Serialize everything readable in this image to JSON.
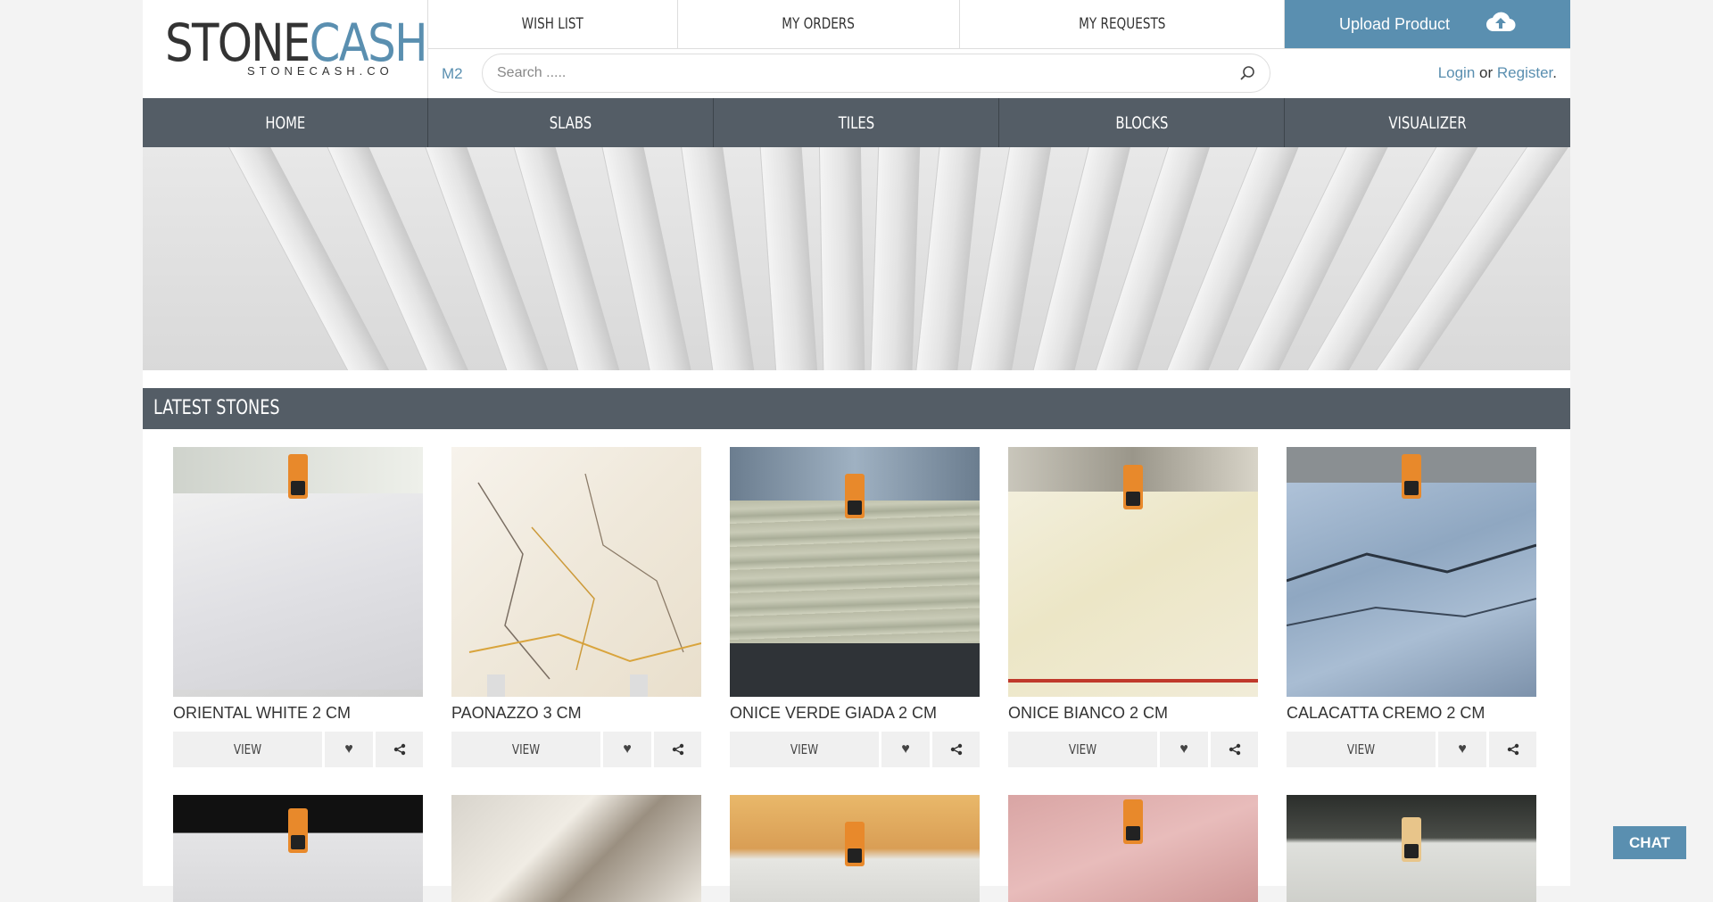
{
  "brand": {
    "name_part1": "STONE",
    "name_part2": "CASH",
    "subtitle": "STONECASH.CO"
  },
  "topnav": {
    "wish_list": "WISH LIST",
    "my_orders": "MY ORDERS",
    "my_requests": "MY REQUESTS",
    "upload": "Upload Product"
  },
  "search": {
    "unit": "M2",
    "placeholder": "Search ....."
  },
  "auth": {
    "login": "Login",
    "or": "or",
    "register": "Register",
    "suffix": "."
  },
  "mainnav": [
    "HOME",
    "SLABS",
    "TILES",
    "BLOCKS",
    "VISUALIZER"
  ],
  "section": {
    "title": "LATEST STONES"
  },
  "products": [
    {
      "name": "ORIENTAL WHITE 2 CM",
      "view_label": "VIEW"
    },
    {
      "name": "PAONAZZO 3 CM",
      "view_label": "VIEW"
    },
    {
      "name": "ONICE VERDE GIADA 2 CM",
      "view_label": "VIEW"
    },
    {
      "name": "ONICE BIANCO 2 CM",
      "view_label": "VIEW"
    },
    {
      "name": "CALACATTA CREMO 2 CM",
      "view_label": "VIEW"
    }
  ],
  "chat": {
    "label": "CHAT"
  },
  "colors": {
    "accent": "#5a8fb0",
    "nav_bg": "#545d66"
  }
}
